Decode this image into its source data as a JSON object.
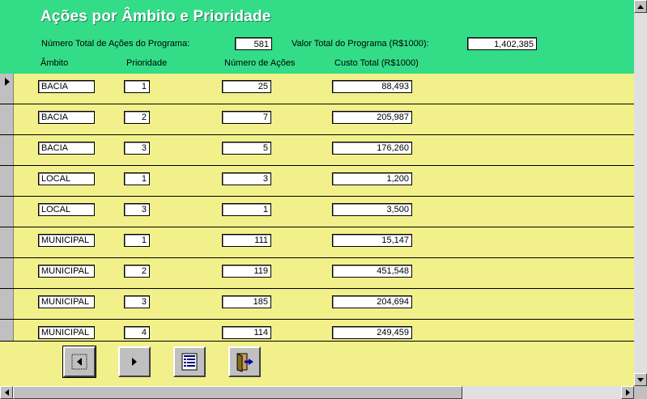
{
  "header": {
    "title": "Ações por Âmbito e Prioridade",
    "total_actions_label": "Número Total de Ações do Programa:",
    "total_actions_value": "581",
    "total_value_label": "Valor Total do Programa (R$1000):",
    "total_value_value": "1,402,385"
  },
  "columns": {
    "ambito": "Âmbito",
    "prioridade": "Prioridade",
    "numero": "Número de Ações",
    "custo": "Custo Total (R$1000)"
  },
  "rows": [
    {
      "ambito": "BACIA",
      "prioridade": "1",
      "numero": "25",
      "custo": "88,493"
    },
    {
      "ambito": "BACIA",
      "prioridade": "2",
      "numero": "7",
      "custo": "205,987"
    },
    {
      "ambito": "BACIA",
      "prioridade": "3",
      "numero": "5",
      "custo": "176,260"
    },
    {
      "ambito": "LOCAL",
      "prioridade": "1",
      "numero": "3",
      "custo": "1,200"
    },
    {
      "ambito": "LOCAL",
      "prioridade": "3",
      "numero": "1",
      "custo": "3,500"
    },
    {
      "ambito": "MUNICIPAL",
      "prioridade": "1",
      "numero": "111",
      "custo": "15,147"
    },
    {
      "ambito": "MUNICIPAL",
      "prioridade": "2",
      "numero": "119",
      "custo": "451,548"
    },
    {
      "ambito": "MUNICIPAL",
      "prioridade": "3",
      "numero": "185",
      "custo": "204,694"
    },
    {
      "ambito": "MUNICIPAL",
      "prioridade": "4",
      "numero": "114",
      "custo": "249,459"
    }
  ],
  "footer_buttons": [
    {
      "name": "previous-record-button",
      "icon": "arrow-left-icon"
    },
    {
      "name": "next-record-button",
      "icon": "arrow-right-icon"
    },
    {
      "name": "report-button",
      "icon": "report-icon"
    },
    {
      "name": "exit-button",
      "icon": "exit-door-icon"
    }
  ],
  "colors": {
    "header": "#33dd88",
    "detail": "#f2f08a"
  }
}
